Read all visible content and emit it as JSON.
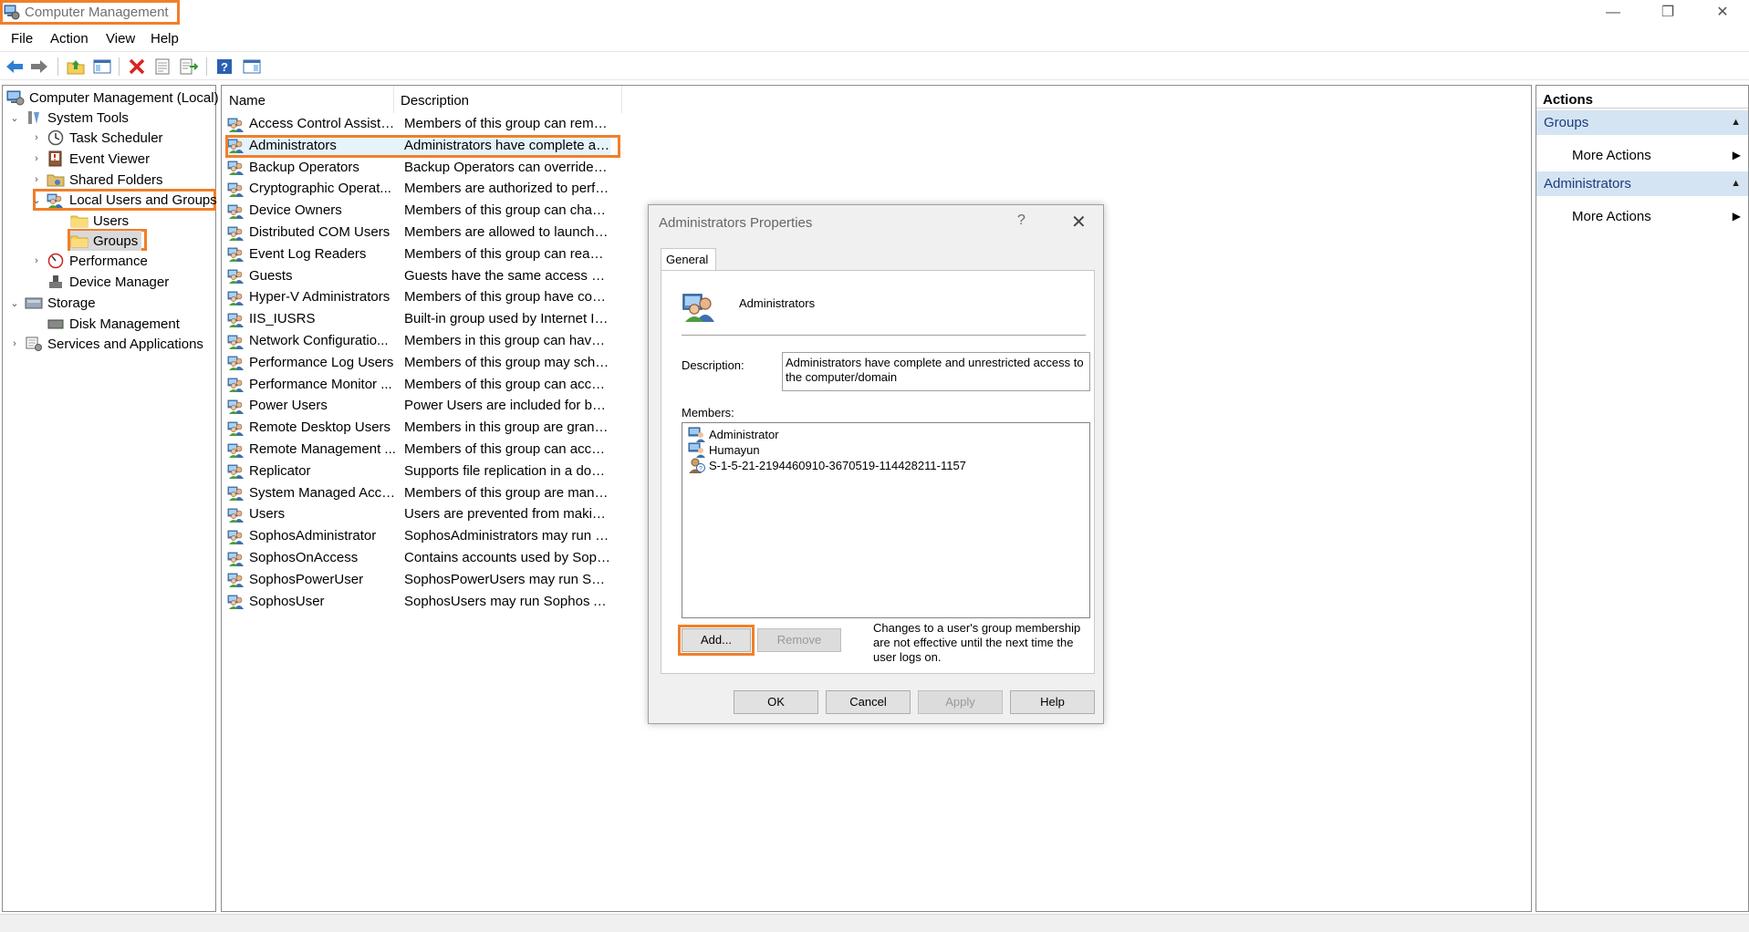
{
  "window": {
    "title": "Computer Management",
    "controls": {
      "minimize": "—",
      "restore": "❐",
      "close": "✕"
    }
  },
  "menu": [
    "File",
    "Action",
    "View",
    "Help"
  ],
  "toolbar": {
    "icons": [
      "back-icon",
      "forward-icon",
      "up-folder-icon",
      "show-hide-tree-icon",
      "delete-icon",
      "properties-icon",
      "export-icon",
      "help-icon",
      "show-hide-action-pane-icon"
    ]
  },
  "tree": {
    "root": "Computer Management (Local)",
    "system_tools": "System Tools",
    "task_scheduler": "Task Scheduler",
    "event_viewer": "Event Viewer",
    "shared_folders": "Shared Folders",
    "local_users_groups": "Local Users and Groups",
    "users": "Users",
    "groups": "Groups",
    "performance": "Performance",
    "device_manager": "Device Manager",
    "storage": "Storage",
    "disk_management": "Disk Management",
    "services_apps": "Services and Applications"
  },
  "list": {
    "columns": {
      "name": "Name",
      "description": "Description"
    },
    "rows": [
      {
        "name": "Access Control Assista...",
        "desc": "Members of this group can remot..."
      },
      {
        "name": "Administrators",
        "desc": "Administrators have complete and..."
      },
      {
        "name": "Backup Operators",
        "desc": "Backup Operators can override sec..."
      },
      {
        "name": "Cryptographic Operat...",
        "desc": "Members are authorized to perfor..."
      },
      {
        "name": "Device Owners",
        "desc": "Members of this group can chang..."
      },
      {
        "name": "Distributed COM Users",
        "desc": "Members are allowed to launch, ac..."
      },
      {
        "name": "Event Log Readers",
        "desc": "Members of this group can read e..."
      },
      {
        "name": "Guests",
        "desc": "Guests have the same access as m..."
      },
      {
        "name": "Hyper-V Administrators",
        "desc": "Members of this group have comp..."
      },
      {
        "name": "IIS_IUSRS",
        "desc": "Built-in group used by Internet Inf..."
      },
      {
        "name": "Network Configuratio...",
        "desc": "Members in this group can have s..."
      },
      {
        "name": "Performance Log Users",
        "desc": "Members of this group may sched..."
      },
      {
        "name": "Performance Monitor ...",
        "desc": "Members of this group can access ..."
      },
      {
        "name": "Power Users",
        "desc": "Power Users are included for back..."
      },
      {
        "name": "Remote Desktop Users",
        "desc": "Members in this group are grante..."
      },
      {
        "name": "Remote Management ...",
        "desc": "Members of this group can access ..."
      },
      {
        "name": "Replicator",
        "desc": "Supports file replication in a doma..."
      },
      {
        "name": "System Managed Acco...",
        "desc": "Members of this group are manag..."
      },
      {
        "name": "Users",
        "desc": "Users are prevented from making ..."
      },
      {
        "name": "SophosAdministrator",
        "desc": "SophosAdministrators may run So..."
      },
      {
        "name": "SophosOnAccess",
        "desc": "Contains accounts used by Sopho..."
      },
      {
        "name": "SophosPowerUser",
        "desc": "SophosPowerUsers may run Soph..."
      },
      {
        "name": "SophosUser",
        "desc": "SophosUsers may run Sophos Anti..."
      }
    ]
  },
  "actions": {
    "header": "Actions",
    "section1": "Groups",
    "section1_item": "More Actions",
    "section2": "Administrators",
    "section2_item": "More Actions"
  },
  "dialog": {
    "title": "Administrators Properties",
    "help_glyph": "?",
    "close_glyph": "✕",
    "tab": "General",
    "group_name": "Administrators",
    "description_label": "Description:",
    "description": "Administrators have complete and unrestricted access to the computer/domain",
    "members_label": "Members:",
    "members": [
      {
        "name": "Administrator",
        "icon": "user-icon"
      },
      {
        "name": "Humayun",
        "icon": "user-icon"
      },
      {
        "name": "S-1-5-21-2194460910-3670519-114428211-1157",
        "icon": "unknown-account-icon"
      }
    ],
    "add_label": "Add...",
    "remove_label": "Remove",
    "note": "Changes to a user's group membership are not effective until the next time the user logs on.",
    "ok_label": "OK",
    "cancel_label": "Cancel",
    "apply_label": "Apply",
    "help_label": "Help"
  },
  "colors": {
    "highlight": "#f07f2a",
    "selection": "#e5f3fb",
    "action_section": "#d4e4f3"
  }
}
